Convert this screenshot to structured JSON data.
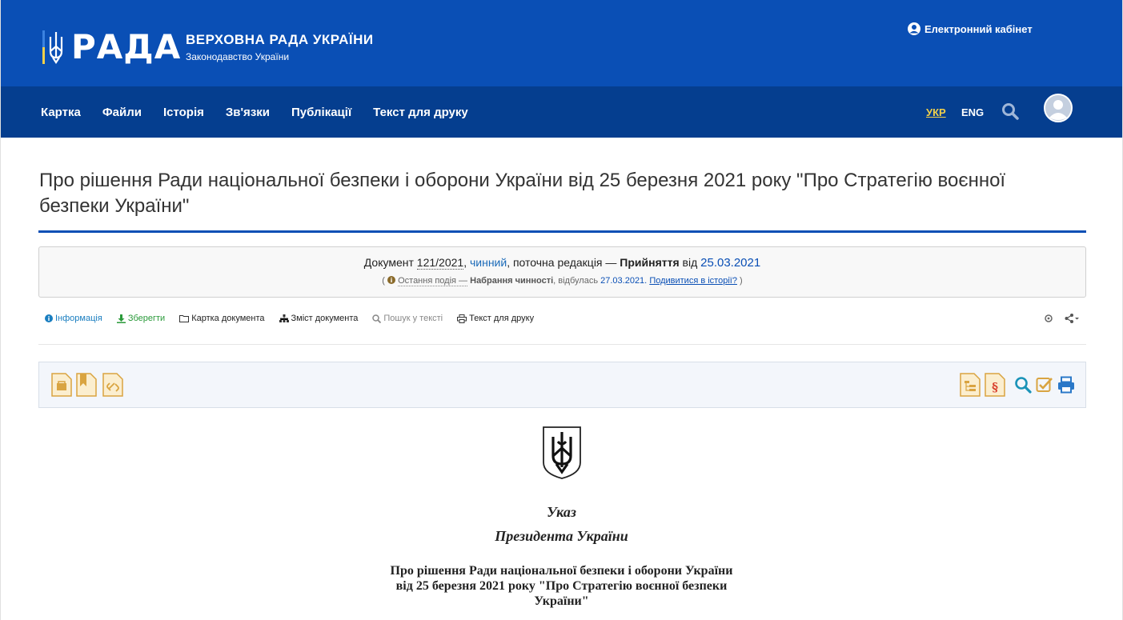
{
  "header": {
    "logo_word": "РАДА",
    "brand_title": "ВЕРХОВНА РАДА УКРАЇНИ",
    "brand_sub": "Законодавство України",
    "cabinet": "Електронний кабінет",
    "brand_color": "#0a4fb5",
    "nav_color": "#053e8f"
  },
  "nav": {
    "items": [
      "Картка",
      "Файли",
      "Історія",
      "Зв'язки",
      "Публікації",
      "Текст для друку"
    ],
    "lang_ukr": "УКР",
    "lang_eng": "ENG"
  },
  "document": {
    "title": "Про рішення Ради національної безпеки і оборони України від 25 березня 2021 року \"Про Стратегію воєнної безпеки України\"",
    "status": {
      "prefix": "Документ",
      "number": "121/2021",
      "state": "чинний",
      "edition": ", поточна редакція —",
      "event": "Прийняття",
      "from": "від",
      "date": "25.03.2021",
      "last_event_label": "Остання подія —",
      "last_event": "Набрання чинності",
      "happened": ", відбулась",
      "last_date": "27.03.2021.",
      "history_link": "Подивитися в історії?"
    }
  },
  "toolbar": {
    "info": "Інформація",
    "save": "Зберегти",
    "card": "Картка документа",
    "contents": "Зміст документа",
    "search": "Пошук у тексті",
    "print": "Текст для друку"
  },
  "decree": {
    "line1": "Указ",
    "line2": "Президента України",
    "heading": [
      "Про рішення Ради національної безпеки і оборони України",
      "від 25 березня 2021 року \"Про Стратегію воєнної безпеки",
      "України\""
    ]
  }
}
